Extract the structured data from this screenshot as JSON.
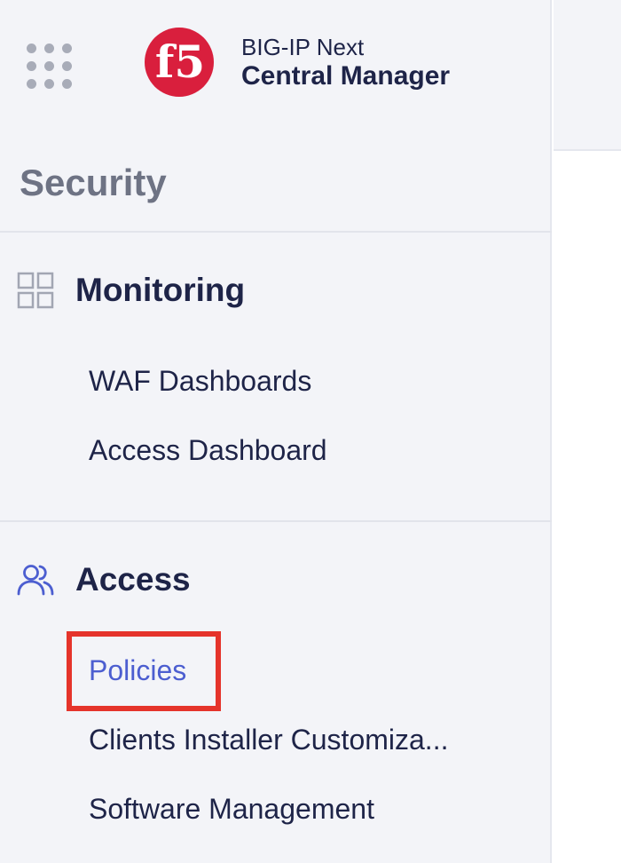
{
  "header": {
    "logo_text": "f5",
    "brand_line1": "BIG-IP Next",
    "brand_line2": "Central Manager"
  },
  "sidebar": {
    "section_title": "Security",
    "groups": [
      {
        "label": "Monitoring",
        "icon": "grid-icon",
        "items": [
          {
            "label": "WAF Dashboards"
          },
          {
            "label": "Access Dashboard"
          }
        ]
      },
      {
        "label": "Access",
        "icon": "users-icon",
        "items": [
          {
            "label": "Policies",
            "active": true
          },
          {
            "label": "Clients Installer Customiza..."
          },
          {
            "label": "Software Management"
          }
        ]
      }
    ]
  },
  "colors": {
    "sidebar_bg": "#f3f4f8",
    "text_primary": "#1e2448",
    "accent": "#4c5ed0",
    "brand_red": "#d91f3d",
    "highlight": "#e5342b"
  }
}
